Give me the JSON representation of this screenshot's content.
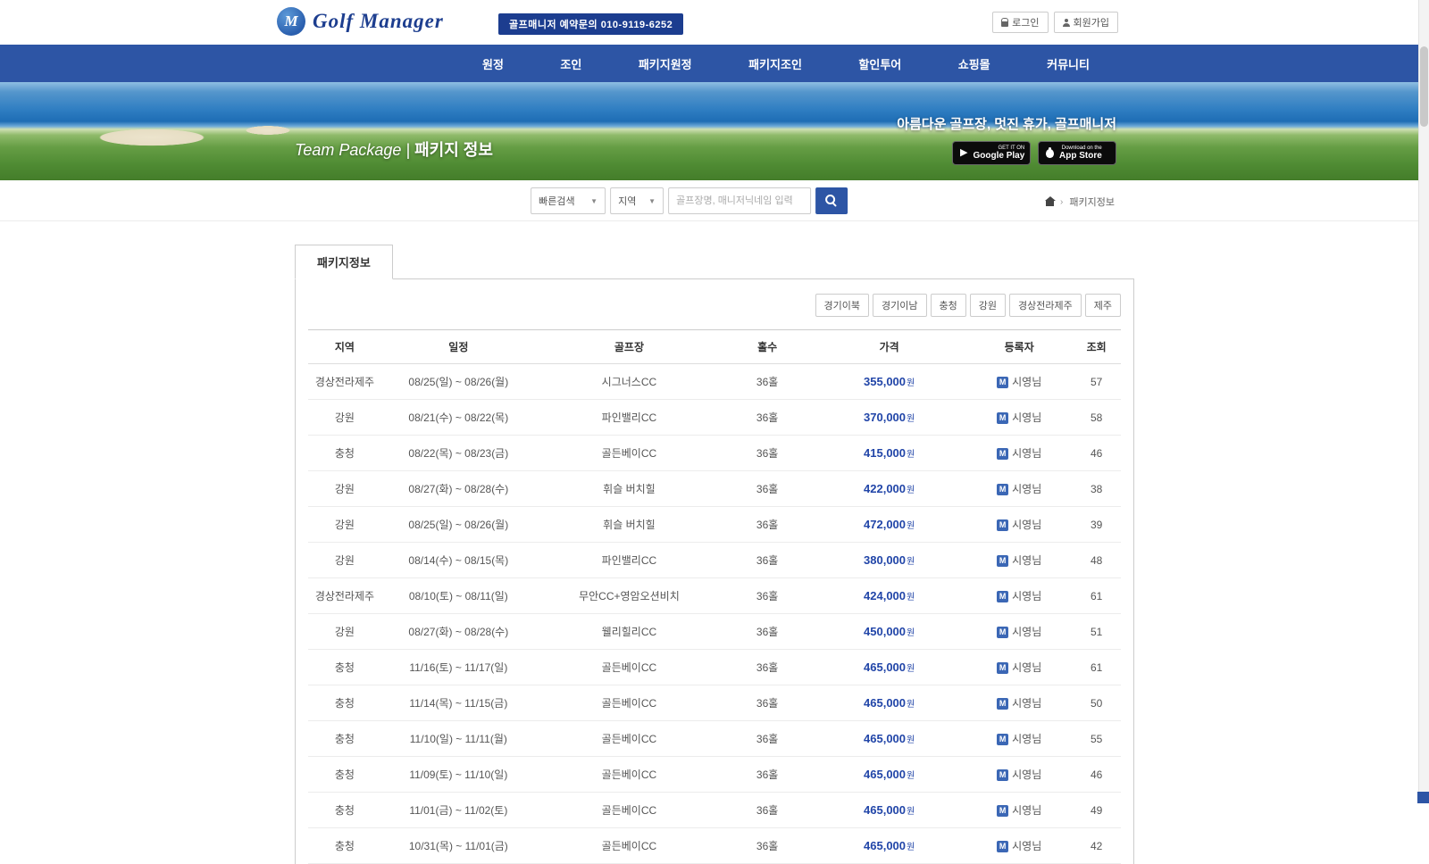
{
  "header": {
    "logo_letter": "M",
    "logo_text": "Golf Manager",
    "phone_badge": "골프매니저 예약문의 010-9119-6252",
    "login_label": "로그인",
    "signup_label": "회원가입"
  },
  "nav": {
    "items": [
      {
        "id": "tour",
        "label": "원정"
      },
      {
        "id": "join",
        "label": "조인"
      },
      {
        "id": "package-tour",
        "label": "패키지원정"
      },
      {
        "id": "package-join",
        "label": "패키지조인"
      },
      {
        "id": "discount-tour",
        "label": "할인투어"
      },
      {
        "id": "shop",
        "label": "쇼핑몰"
      },
      {
        "id": "community",
        "label": "커뮤니티"
      }
    ]
  },
  "hero": {
    "title_en": "Team Package |",
    "title_ko": "패키지 정보",
    "slogan": "아름다운 골프장, 멋진 휴가, 골프매니저",
    "google_play_small": "GET IT ON",
    "google_play_big": "Google Play",
    "app_store_small": "Download on the",
    "app_store_big": "App Store"
  },
  "search": {
    "quick_label": "빠른검색",
    "region_label": "지역",
    "placeholder": "골프장명, 매니저닉네임 입력",
    "breadcrumb_current": "패키지정보"
  },
  "content": {
    "tab_label": "패키지정보",
    "filters": [
      {
        "id": "gyeonggi-north",
        "label": "경기이북"
      },
      {
        "id": "gyeonggi-south",
        "label": "경기이남"
      },
      {
        "id": "chungcheong",
        "label": "충청"
      },
      {
        "id": "gangwon",
        "label": "강원"
      },
      {
        "id": "gyeongsang-jeolla-jeju",
        "label": "경상전라제주"
      },
      {
        "id": "jeju",
        "label": "제주"
      }
    ],
    "table": {
      "headers": [
        "지역",
        "일정",
        "골프장",
        "홀수",
        "가격",
        "등록자",
        "조회"
      ],
      "won_suffix": "원",
      "registrant_badge": "M",
      "rows": [
        {
          "region": "경상전라제주",
          "schedule": "08/25(일) ~ 08/26(월)",
          "course": "시그너스CC",
          "holes": "36홀",
          "price": "355,000",
          "registrant": "시영님",
          "views": "57"
        },
        {
          "region": "강원",
          "schedule": "08/21(수) ~ 08/22(목)",
          "course": "파인밸리CC",
          "holes": "36홀",
          "price": "370,000",
          "registrant": "시영님",
          "views": "58"
        },
        {
          "region": "충청",
          "schedule": "08/22(목) ~ 08/23(금)",
          "course": "골든베이CC",
          "holes": "36홀",
          "price": "415,000",
          "registrant": "시영님",
          "views": "46"
        },
        {
          "region": "강원",
          "schedule": "08/27(화) ~ 08/28(수)",
          "course": "휘슬 버치힐",
          "holes": "36홀",
          "price": "422,000",
          "registrant": "시영님",
          "views": "38"
        },
        {
          "region": "강원",
          "schedule": "08/25(일) ~ 08/26(월)",
          "course": "휘슬 버치힐",
          "holes": "36홀",
          "price": "472,000",
          "registrant": "시영님",
          "views": "39"
        },
        {
          "region": "강원",
          "schedule": "08/14(수) ~ 08/15(목)",
          "course": "파인밸리CC",
          "holes": "36홀",
          "price": "380,000",
          "registrant": "시영님",
          "views": "48"
        },
        {
          "region": "경상전라제주",
          "schedule": "08/10(토) ~ 08/11(일)",
          "course": "무안CC+영암오션비치",
          "holes": "36홀",
          "price": "424,000",
          "registrant": "시영님",
          "views": "61"
        },
        {
          "region": "강원",
          "schedule": "08/27(화) ~ 08/28(수)",
          "course": "웰리힐리CC",
          "holes": "36홀",
          "price": "450,000",
          "registrant": "시영님",
          "views": "51"
        },
        {
          "region": "충청",
          "schedule": "11/16(토) ~ 11/17(일)",
          "course": "골든베이CC",
          "holes": "36홀",
          "price": "465,000",
          "registrant": "시영님",
          "views": "61"
        },
        {
          "region": "충청",
          "schedule": "11/14(목) ~ 11/15(금)",
          "course": "골든베이CC",
          "holes": "36홀",
          "price": "465,000",
          "registrant": "시영님",
          "views": "50"
        },
        {
          "region": "충청",
          "schedule": "11/10(일) ~ 11/11(월)",
          "course": "골든베이CC",
          "holes": "36홀",
          "price": "465,000",
          "registrant": "시영님",
          "views": "55"
        },
        {
          "region": "충청",
          "schedule": "11/09(토) ~ 11/10(일)",
          "course": "골든베이CC",
          "holes": "36홀",
          "price": "465,000",
          "registrant": "시영님",
          "views": "46"
        },
        {
          "region": "충청",
          "schedule": "11/01(금) ~ 11/02(토)",
          "course": "골든베이CC",
          "holes": "36홀",
          "price": "465,000",
          "registrant": "시영님",
          "views": "49"
        },
        {
          "region": "충청",
          "schedule": "10/31(목) ~ 11/01(금)",
          "course": "골든베이CC",
          "holes": "36홀",
          "price": "465,000",
          "registrant": "시영님",
          "views": "42"
        }
      ]
    }
  }
}
